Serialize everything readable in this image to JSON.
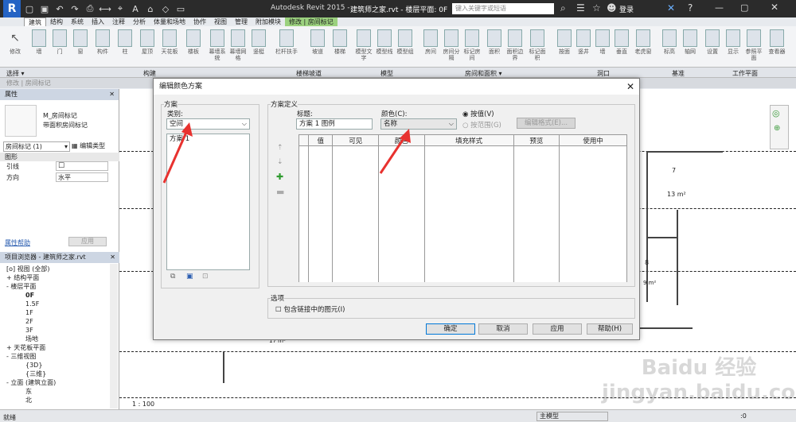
{
  "app": {
    "title": "Autodesk Revit 2015 -",
    "file": "建筑师之家.rvt - 楼层平面: 0F",
    "search_placeholder": "键入关键字或短语",
    "login": "登录"
  },
  "tabs": [
    "建筑",
    "结构",
    "系统",
    "插入",
    "注释",
    "分析",
    "体量和场地",
    "协作",
    "视图",
    "管理",
    "附加模块",
    "修改 | 房间标记"
  ],
  "ribbon": {
    "buttons": [
      "修改",
      "墙",
      "门",
      "窗",
      "构件",
      "柱",
      "屋顶",
      "天花板",
      "楼板",
      "幕墙系统",
      "幕墙网格",
      "竖梃",
      "栏杆扶手",
      "坡道",
      "楼梯",
      "模型文字",
      "模型线",
      "模型组",
      "房间",
      "房间分隔",
      "标记房间",
      "面积",
      "面积边界",
      "标记面积",
      "按面",
      "竖井",
      "墙",
      "垂直",
      "老虎窗",
      "标高",
      "轴网",
      "设置",
      "显示",
      "参照平面",
      "查看器"
    ],
    "panels": [
      "选择 ▾",
      "构建",
      "楼梯坡道",
      "模型",
      "房间和面积 ▾",
      "洞口",
      "基准",
      "工作平面"
    ]
  },
  "option_bar": "修改 | 房间标记",
  "properties": {
    "header": "属性",
    "type_name": "M_房间标记",
    "type_sub": "带面积房间标记",
    "instance_select": "房间标记 (1)",
    "edit_type": "编辑类型",
    "section": "图形",
    "rows": [
      {
        "name": "引线",
        "value": "☐"
      },
      {
        "name": "方向",
        "value": "水平"
      }
    ],
    "help_link": "属性帮助",
    "apply": "应用"
  },
  "browser": {
    "header": "项目浏览器 - 建筑师之家.rvt",
    "items": [
      "[o] 视图 (全部)",
      "+ 结构平面",
      "- 楼层平面",
      "0F",
      "1.5F",
      "1F",
      "2F",
      "3F",
      "场地",
      "+ 天花板平面",
      "- 三维视图",
      "{3D}",
      "{三维}",
      "- 立面 (建筑立面)",
      "东",
      "北"
    ]
  },
  "status": {
    "ready": "就绪",
    "scale": "1 : 100",
    "model": "主模型",
    "filter": ":0"
  },
  "dialog": {
    "title": "编辑颜色方案",
    "scheme_label": "方案",
    "category_label": "类别:",
    "category_value": "空间",
    "scheme_list": [
      "方案 1"
    ],
    "definition_label": "方案定义",
    "title_label": "标题:",
    "title_value": "方案 1 图例",
    "color_label": "颜色(C):",
    "color_value": "名称",
    "by_value": "按值(V)",
    "by_range": "按范围(G)",
    "edit_format": "编辑格式(E)...",
    "columns": [
      "值",
      "可见",
      "颜色",
      "填充样式",
      "预览",
      "使用中"
    ],
    "options_label": "选项",
    "include_linked": "包含链接中的图元(I)",
    "ok": "确定",
    "cancel": "取消",
    "apply": "应用",
    "help": "帮助(H)"
  },
  "canvas_labels": {
    "room7": "7",
    "area7": "13 m²",
    "room8": "8",
    "area8": "9 m²",
    "area_left": "17 m²"
  },
  "colors": {
    "title_bg": "#2b2b2b",
    "accent": "#0078d7",
    "arrow": "#e8322f",
    "tab_highlight": "#9bd17e"
  },
  "watermark": "Baidu 经验 jingyan.baidu.com"
}
